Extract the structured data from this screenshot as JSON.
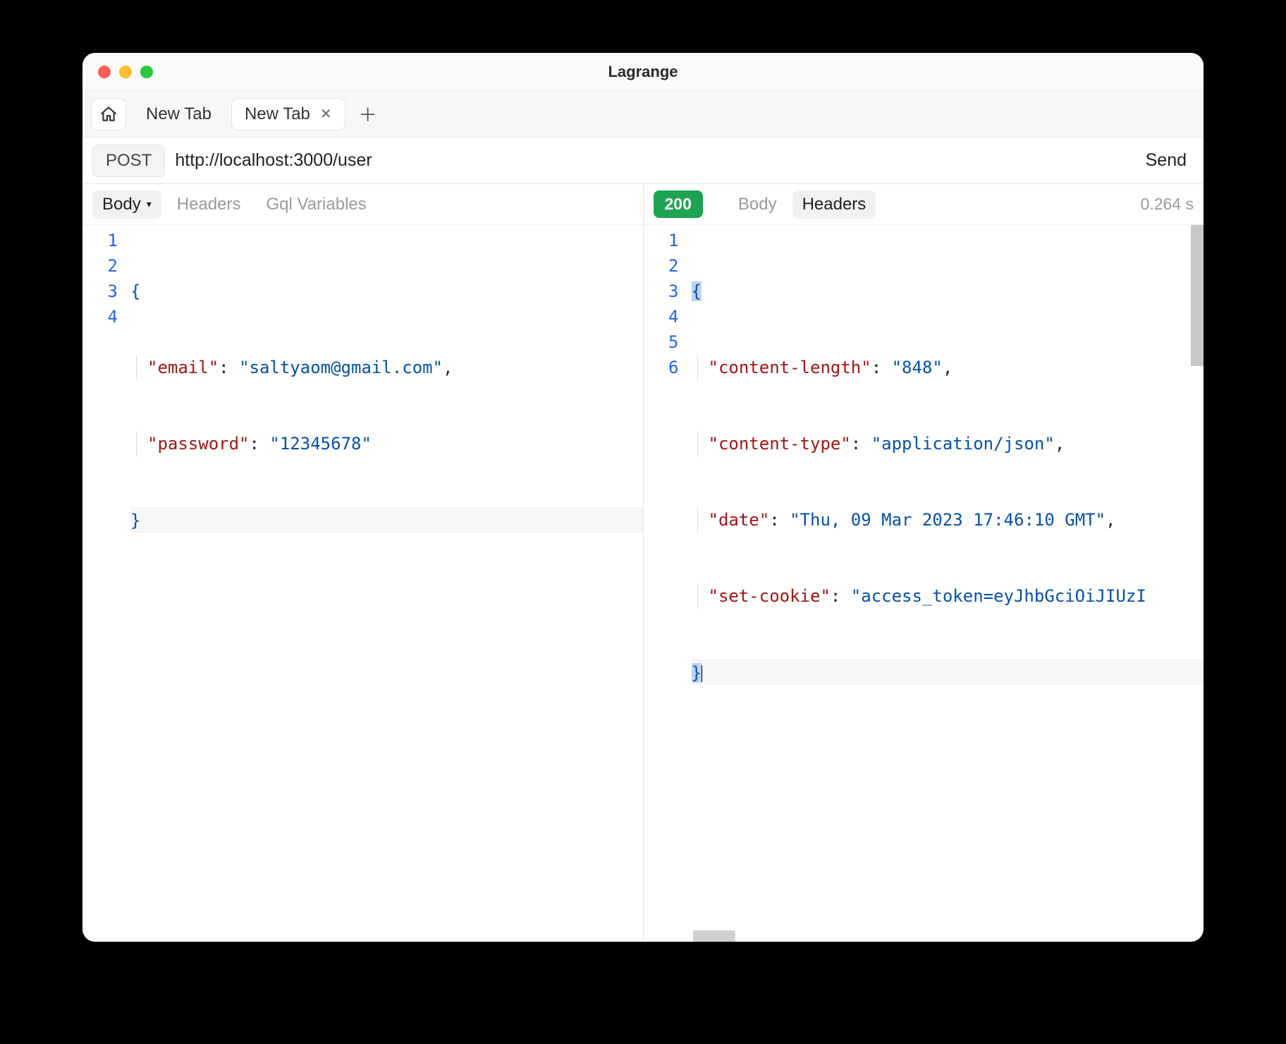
{
  "window": {
    "title": "Lagrange"
  },
  "tabs": {
    "items": [
      {
        "label": "New Tab",
        "active": false
      },
      {
        "label": "New Tab",
        "active": true
      }
    ]
  },
  "request": {
    "method": "POST",
    "url": "http://localhost:3000/user",
    "send_label": "Send"
  },
  "reqpanel": {
    "tabs": {
      "body": "Body",
      "headers": "Headers",
      "gql": "Gql Variables"
    },
    "body_lines": [
      {
        "n": "1",
        "type": "brace",
        "text": "{"
      },
      {
        "n": "2",
        "type": "kv",
        "key": "\"email\"",
        "sep": ": ",
        "val": "\"saltyaom@gmail.com\"",
        "trail": ","
      },
      {
        "n": "3",
        "type": "kv",
        "key": "\"password\"",
        "sep": ": ",
        "val": "\"12345678\"",
        "trail": ""
      },
      {
        "n": "4",
        "type": "brace",
        "text": "}"
      }
    ]
  },
  "response": {
    "status": "200",
    "tabs": {
      "body": "Body",
      "headers": "Headers"
    },
    "timing": "0.264 s",
    "header_lines": [
      {
        "n": "1",
        "type": "brace",
        "text": "{"
      },
      {
        "n": "2",
        "type": "kv",
        "key": "\"content-length\"",
        "sep": ": ",
        "val": "\"848\"",
        "trail": ","
      },
      {
        "n": "3",
        "type": "kv",
        "key": "\"content-type\"",
        "sep": ": ",
        "val": "\"application/json\"",
        "trail": ","
      },
      {
        "n": "4",
        "type": "kv",
        "key": "\"date\"",
        "sep": ": ",
        "val": "\"Thu, 09 Mar 2023 17:46:10 GMT\"",
        "trail": ","
      },
      {
        "n": "5",
        "type": "kv",
        "key": "\"set-cookie\"",
        "sep": ": ",
        "val": "\"access_token=eyJhbGciOiJIUzI",
        "trail": ""
      },
      {
        "n": "6",
        "type": "brace",
        "text": "}"
      }
    ]
  }
}
